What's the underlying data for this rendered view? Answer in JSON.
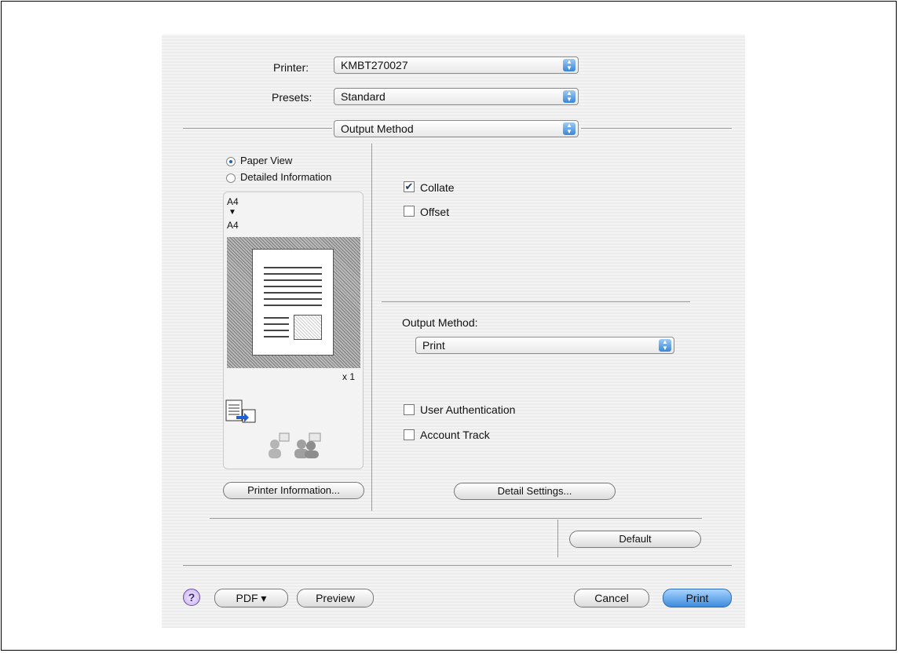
{
  "printer": {
    "label": "Printer:",
    "value": "KMBT270027"
  },
  "presets": {
    "label": "Presets:",
    "value": "Standard"
  },
  "panel_select": {
    "value": "Output Method"
  },
  "view_options": {
    "paper_view": "Paper View",
    "detailed_information": "Detailed Information"
  },
  "preview": {
    "input_size": "A4",
    "arrow": "▼",
    "output_size": "A4",
    "copies": "x 1"
  },
  "printer_information_button": "Printer Information...",
  "collate": {
    "label": "Collate",
    "checked": true
  },
  "offset": {
    "label": "Offset",
    "checked": false
  },
  "output_method": {
    "label": "Output Method:",
    "value": "Print"
  },
  "user_authentication": {
    "label": "User Authentication",
    "checked": false
  },
  "account_track": {
    "label": "Account Track",
    "checked": false
  },
  "detail_settings_button": "Detail Settings...",
  "default_button": "Default",
  "bottom_bar": {
    "help": "?",
    "pdf": "PDF ▾",
    "preview": "Preview",
    "cancel": "Cancel",
    "print": "Print"
  }
}
